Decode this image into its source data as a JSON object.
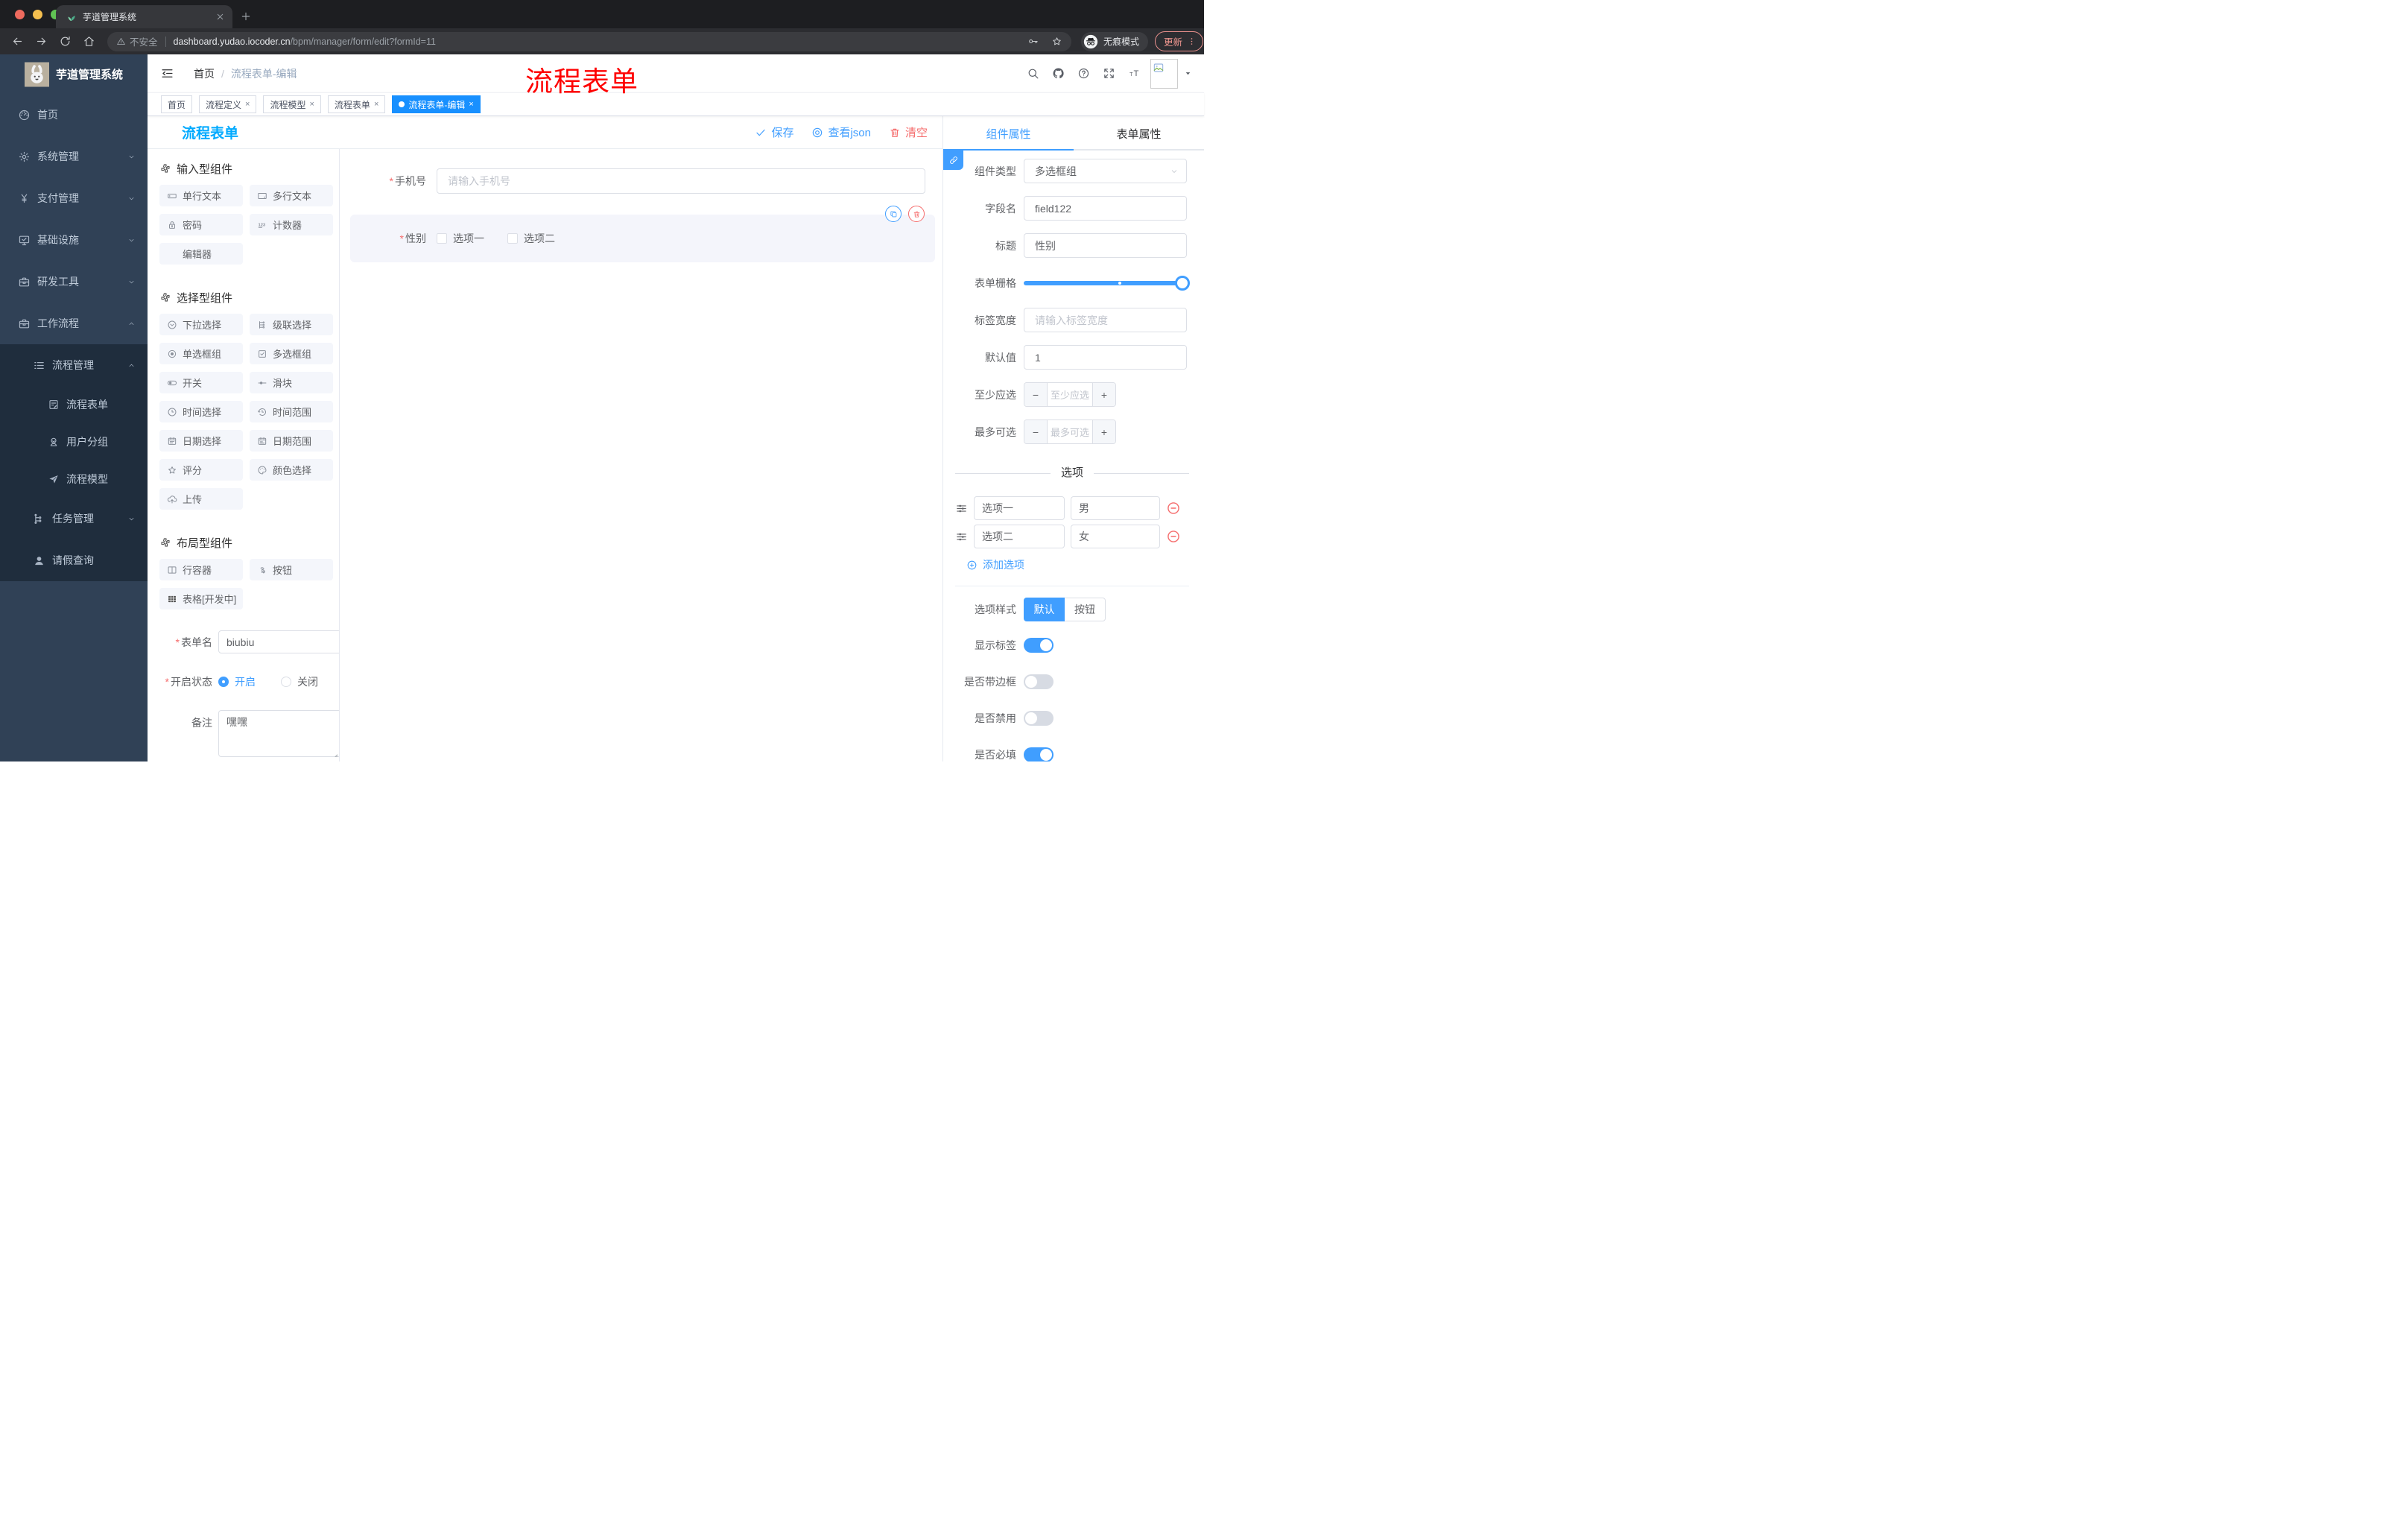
{
  "browser": {
    "tab_title": "芋道管理系统",
    "security_label": "不安全",
    "url_domain": "dashboard.yudao.iocoder.cn",
    "url_path": "/bpm/manager/form/edit?formId=11",
    "incognito_label": "无痕模式",
    "update_label": "更新"
  },
  "sidebar": {
    "logo_title": "芋道管理系统",
    "items": [
      {
        "label": "首页",
        "icon": "dashboard"
      },
      {
        "label": "系统管理",
        "icon": "gear"
      },
      {
        "label": "支付管理",
        "icon": "yen"
      },
      {
        "label": "基础设施",
        "icon": "monitor"
      },
      {
        "label": "研发工具",
        "icon": "toolbox"
      },
      {
        "label": "工作流程",
        "icon": "toolbox"
      },
      {
        "label": "流程管理",
        "icon": "list-tree"
      },
      {
        "label": "流程表单",
        "icon": "doc-edit"
      },
      {
        "label": "用户分组",
        "icon": "user-group"
      },
      {
        "label": "流程模型",
        "icon": "paper-plane"
      },
      {
        "label": "任务管理",
        "icon": "tree"
      },
      {
        "label": "请假查询",
        "icon": "person"
      }
    ]
  },
  "header": {
    "breadcrumb_home": "首页",
    "breadcrumb_separator": "/",
    "breadcrumb_current": "流程表单-编辑",
    "overlay_title": "流程表单"
  },
  "tags": [
    {
      "label": "首页",
      "closable": false,
      "active": false
    },
    {
      "label": "流程定义",
      "closable": true,
      "active": false
    },
    {
      "label": "流程模型",
      "closable": true,
      "active": false
    },
    {
      "label": "流程表单",
      "closable": true,
      "active": false
    },
    {
      "label": "流程表单-编辑",
      "closable": true,
      "active": true
    }
  ],
  "designer": {
    "page_title": "流程表单",
    "actions": {
      "save": "保存",
      "view_json": "查看json",
      "clear": "清空"
    }
  },
  "components_panel": {
    "sections": [
      {
        "title": "输入型组件",
        "items": [
          {
            "label": "单行文本",
            "icon": "input"
          },
          {
            "label": "多行文本",
            "icon": "textarea"
          },
          {
            "label": "密码",
            "icon": "lock"
          },
          {
            "label": "计数器",
            "icon": "counter"
          },
          {
            "label": "编辑器",
            "icon": ""
          }
        ]
      },
      {
        "title": "选择型组件",
        "items": [
          {
            "label": "下拉选择",
            "icon": "select"
          },
          {
            "label": "级联选择",
            "icon": "cascader"
          },
          {
            "label": "单选框组",
            "icon": "radio"
          },
          {
            "label": "多选框组",
            "icon": "checkbox"
          },
          {
            "label": "开关",
            "icon": "switch"
          },
          {
            "label": "滑块",
            "icon": "slider"
          },
          {
            "label": "时间选择",
            "icon": "time"
          },
          {
            "label": "时间范围",
            "icon": "time-range"
          },
          {
            "label": "日期选择",
            "icon": "date"
          },
          {
            "label": "日期范围",
            "icon": "date-range"
          },
          {
            "label": "评分",
            "icon": "star"
          },
          {
            "label": "颜色选择",
            "icon": "palette"
          },
          {
            "label": "上传",
            "icon": "upload"
          }
        ]
      },
      {
        "title": "布局型组件",
        "items": [
          {
            "label": "行容器",
            "icon": "row-container"
          },
          {
            "label": "按钮",
            "icon": "button-click"
          },
          {
            "label": "表格[开发中]",
            "icon": "table"
          }
        ]
      }
    ],
    "form": {
      "name_label": "表单名",
      "name_value": "biubiu",
      "status_label": "开启状态",
      "status_on": "开启",
      "status_off": "关闭",
      "status_selected": "开启",
      "remark_label": "备注",
      "remark_value": "嘿嘿"
    }
  },
  "canvas": {
    "phone_label": "手机号",
    "phone_placeholder": "请输入手机号",
    "gender_label": "性别",
    "gender_options": [
      "选项一",
      "选项二"
    ]
  },
  "props_panel": {
    "tabs": [
      "组件属性",
      "表单属性"
    ],
    "active_tab": "组件属性",
    "component_type_label": "组件类型",
    "component_type_value": "多选框组",
    "field_name_label": "字段名",
    "field_name_value": "field122",
    "title_label": "标题",
    "title_value": "性别",
    "grid_label": "表单栅格",
    "label_width_label": "标签宽度",
    "label_width_placeholder": "请输入标签宽度",
    "default_label": "默认值",
    "default_value": "1",
    "min_label": "至少应选",
    "min_placeholder": "至少应选",
    "max_label": "最多可选",
    "max_placeholder": "最多可选",
    "options_divider": "选项",
    "options": [
      {
        "label": "选项一",
        "value": "男"
      },
      {
        "label": "选项二",
        "value": "女"
      }
    ],
    "add_option": "添加选项",
    "style_label": "选项样式",
    "style_options": [
      "默认",
      "按钮"
    ],
    "style_selected": "默认",
    "switches": [
      {
        "label": "显示标签",
        "on": true
      },
      {
        "label": "是否带边框",
        "on": false
      },
      {
        "label": "是否禁用",
        "on": false
      },
      {
        "label": "是否必填",
        "on": true
      }
    ]
  },
  "colors": {
    "primary": "#409eff",
    "danger": "#f56c6c",
    "page_title_blue": "#00aaff",
    "overlay_red": "#fe0000",
    "sidebar_bg": "#304156",
    "sidebar_submenu_bg": "#1f2d3d",
    "active_tag_bg": "#1890ff"
  }
}
